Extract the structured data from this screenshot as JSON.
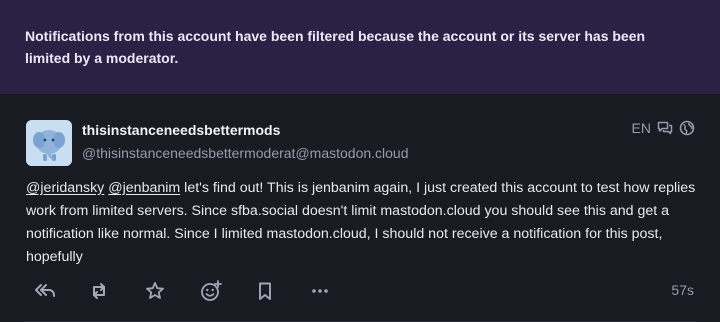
{
  "banner": {
    "text": "Notifications from this account have been filtered because the account or its server has been limited by a moderator."
  },
  "status": {
    "display_name": "thisinstanceneedsbettermods",
    "account": "@thisinstanceneedsbettermoderat@mastodon.cloud",
    "language": "EN",
    "content": {
      "mention1": "@jeridansky",
      "mention2": "@jenbanim",
      "body": " let's find out! This is jenbanim again, I just created this account to test how replies work from limited servers. Since sfba.social doesn't limit mastodon.cloud you should see this and get a notification like normal. Since I limited mastodon.cloud, I should not receive a notification for this post, hopefully"
    },
    "timestamp": "57s",
    "icons": {
      "thread": "thread-icon",
      "visibility": "globe-icon",
      "reply": "reply-all-icon",
      "boost": "boost-icon",
      "favourite": "star-icon",
      "react": "emoji-add-icon",
      "bookmark": "bookmark-icon",
      "more": "more-icon"
    }
  }
}
